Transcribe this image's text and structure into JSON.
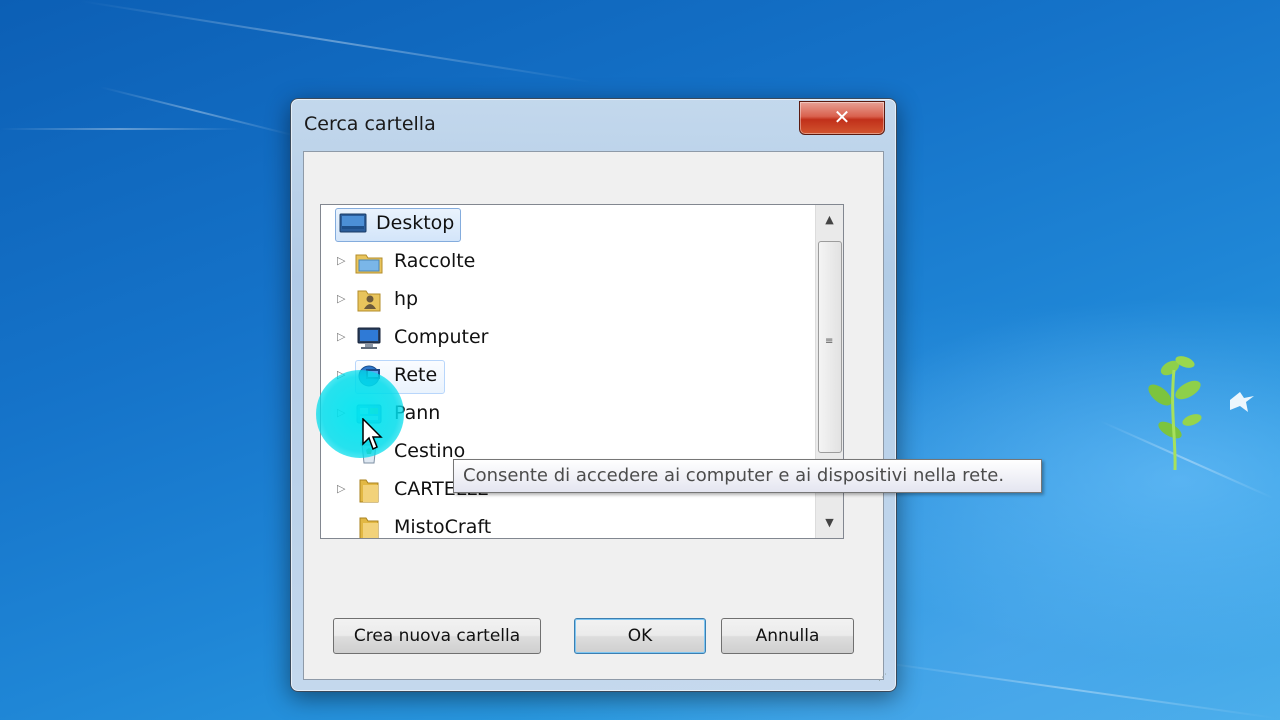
{
  "dialog": {
    "title": "Cerca cartella",
    "close_label": "✕"
  },
  "tree": {
    "items": [
      {
        "label": "Desktop",
        "icon": "desktop-icon",
        "expander": false,
        "selected": true
      },
      {
        "label": "Raccolte",
        "icon": "libraries-icon",
        "expander": true
      },
      {
        "label": "hp",
        "icon": "user-folder-icon",
        "expander": true
      },
      {
        "label": "Computer",
        "icon": "computer-icon",
        "expander": true
      },
      {
        "label": "Rete",
        "icon": "network-icon",
        "expander": true,
        "hovered": true
      },
      {
        "label": "Pann",
        "icon": "control-panel-icon",
        "expander": true
      },
      {
        "label": "Cestino",
        "icon": "recycle-bin-icon",
        "expander": false
      },
      {
        "label": "CARTELLE",
        "icon": "folder-icon",
        "expander": true
      },
      {
        "label": "MistoCraft",
        "icon": "folder-icon",
        "expander": false
      }
    ]
  },
  "tooltip": {
    "text": "Consente di accedere ai computer e ai dispositivi nella rete."
  },
  "buttons": {
    "new_folder": "Crea nuova cartella",
    "ok": "OK",
    "cancel": "Annulla"
  },
  "colors": {
    "selection": "#d3e5fa",
    "cursor_highlight": "#00e6f0",
    "close_red": "#c1301a"
  }
}
